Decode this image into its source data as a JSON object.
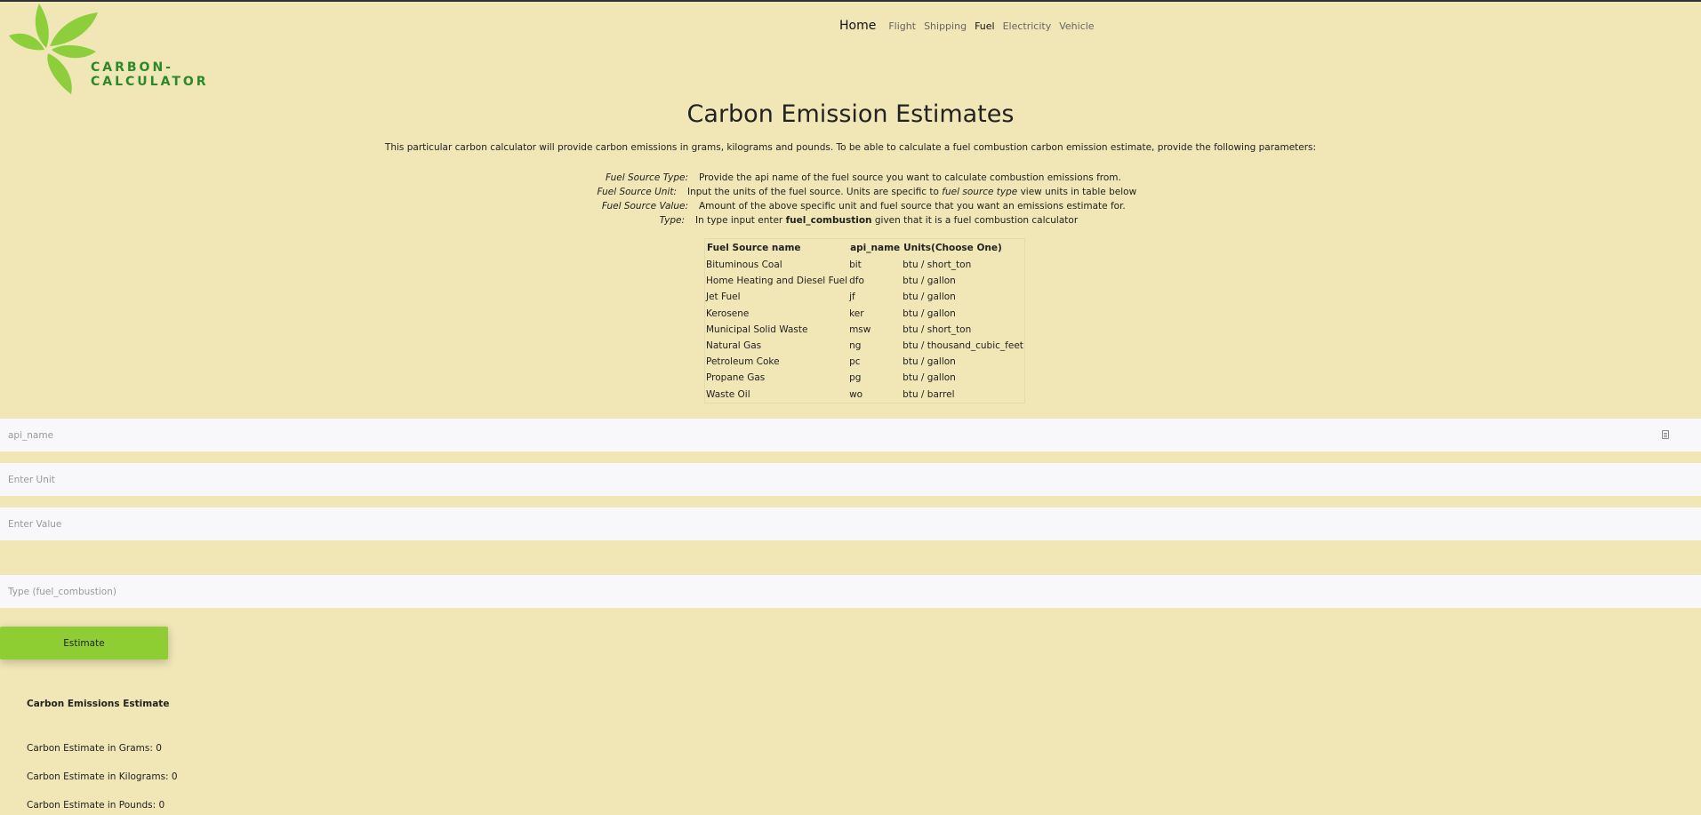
{
  "brand": {
    "name": "CARBON-CALCULATOR",
    "color": "#2a8a2a",
    "leaf_color": "#8ccf3a"
  },
  "nav": {
    "home": "Home",
    "items": [
      "Flight",
      "Shipping",
      "Fuel",
      "Electricity",
      "Vehicle"
    ],
    "active": "Fuel"
  },
  "page": {
    "title": "Carbon Emission Estimates",
    "intro": "This particular carbon calculator will provide carbon emissions in grams, kilograms and pounds. To be able to calculate a fuel combustion carbon emission estimate, provide the following parameters:"
  },
  "params": [
    {
      "label": "Fuel Source Type:",
      "desc": "Provide the api name of the fuel source you want to calculate combustion emissions from."
    },
    {
      "label": "Fuel Source Unit:",
      "desc_pre": "Input the units of the fuel source. Units are specific to ",
      "desc_em": "fuel source type",
      "desc_post": " view units in table below"
    },
    {
      "label": "Fuel Source Value:",
      "desc": "Amount of the above specific unit and fuel source that you want an emissions estimate for."
    },
    {
      "label": "Type:",
      "desc_pre": "In type input enter ",
      "desc_strong": "fuel_combustion",
      "desc_post": " given that it is a fuel combustion calculator"
    }
  ],
  "table": {
    "headers": [
      "Fuel Source name",
      "api_name",
      "Units(Choose One)"
    ],
    "rows": [
      [
        "Bituminous Coal",
        "bit",
        "btu / short_ton"
      ],
      [
        "Home Heating and Diesel Fuel",
        "dfo",
        "btu / gallon"
      ],
      [
        "Jet Fuel",
        "jf",
        "btu / gallon"
      ],
      [
        "Kerosene",
        "ker",
        "btu / gallon"
      ],
      [
        "Municipal Solid Waste",
        "msw",
        "btu / short_ton"
      ],
      [
        "Natural Gas",
        "ng",
        "btu / thousand_cubic_feet"
      ],
      [
        "Petroleum Coke",
        "pc",
        "btu / gallon"
      ],
      [
        "Propane Gas",
        "pg",
        "btu / gallon"
      ],
      [
        "Waste Oil",
        "wo",
        "btu / barrel"
      ]
    ]
  },
  "form": {
    "api_name_placeholder": "api_name",
    "unit_placeholder": "Enter Unit",
    "value_placeholder": "Enter Value",
    "type_placeholder": "Type (fuel_combustion)",
    "submit_label": "Estimate",
    "submit_color": "#8ece33"
  },
  "results": {
    "heading": "Carbon Emissions Estimate",
    "grams_label": "Carbon Estimate in Grams: 0",
    "kilograms_label": "Carbon Estimate in Kilograms: 0",
    "pounds_label": "Carbon Estimate in Pounds: 0"
  }
}
